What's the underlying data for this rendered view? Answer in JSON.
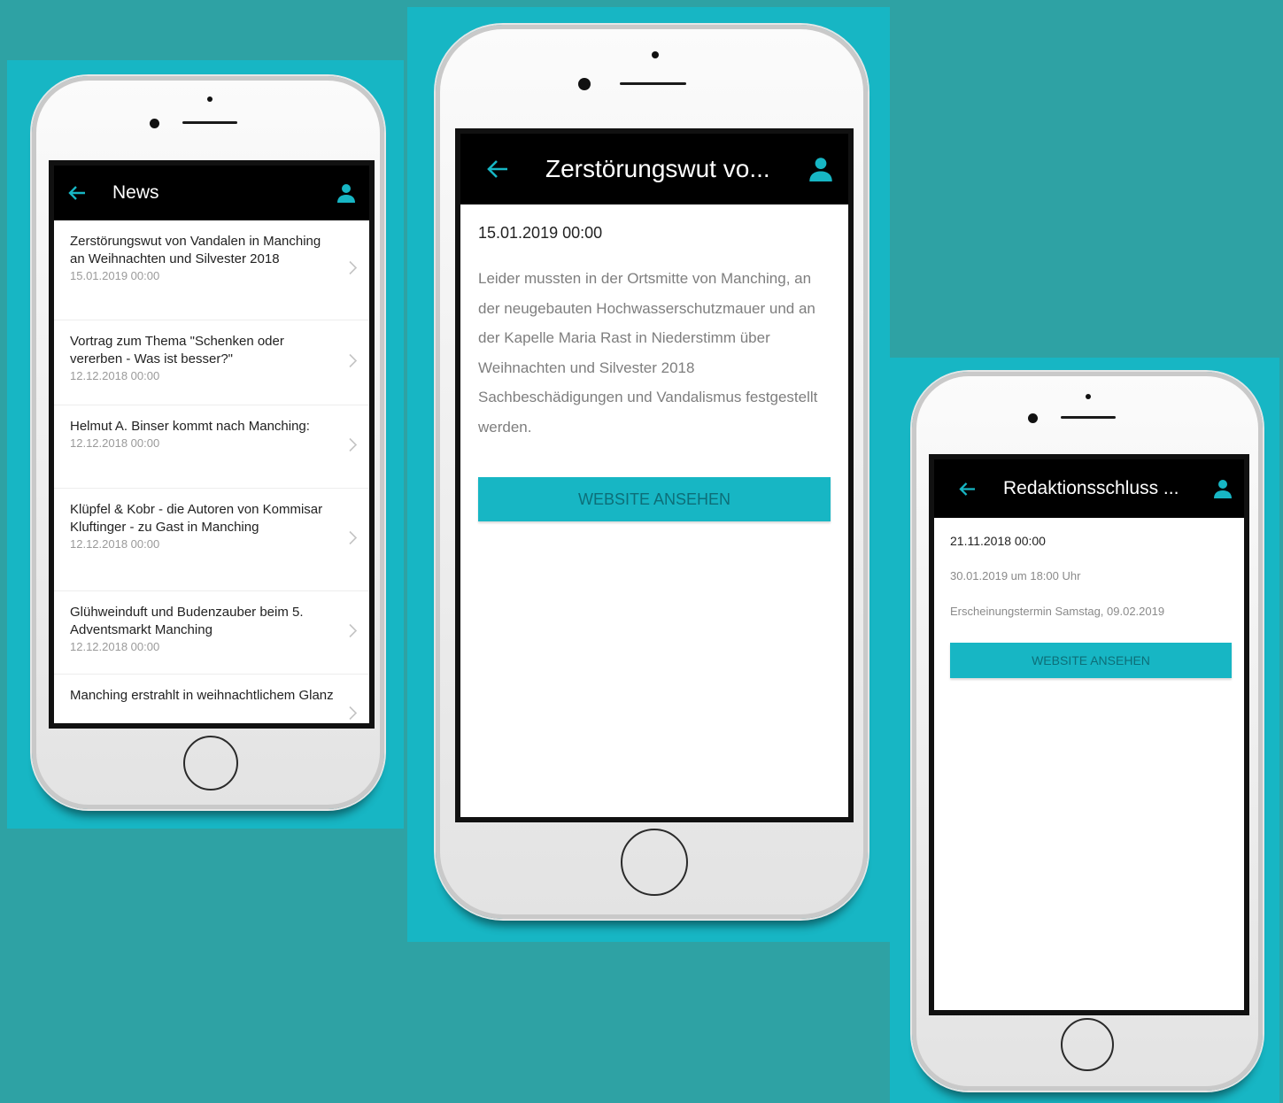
{
  "colors": {
    "accent": "#17b6c4",
    "background": "#2ea2a4",
    "appbar": "#000000"
  },
  "icons": {
    "back": "arrow-left-icon",
    "user": "user-icon",
    "chevron": "chevron-right-icon"
  },
  "phone1": {
    "appbar": {
      "title": "News"
    },
    "news": [
      {
        "title": "Zerstörungswut von Vandalen in Manching an Weihnachten und Silvester 2018",
        "date": "15.01.2019 00:00"
      },
      {
        "title": "Vortrag zum Thema \"Schenken oder vererben - Was ist besser?\"",
        "date": "12.12.2018 00:00"
      },
      {
        "title": "Helmut A. Binser kommt nach Manching:",
        "date": "12.12.2018 00:00"
      },
      {
        "title": "Klüpfel & Kobr - die Autoren von Kommisar Kluftinger - zu Gast in Manching",
        "date": "12.12.2018 00:00"
      },
      {
        "title": "Glühweinduft und Budenzauber beim 5. Adventsmarkt Manching",
        "date": "12.12.2018 00:00"
      },
      {
        "title": "Manching erstrahlt in weihnachtlichem Glanz",
        "date": ""
      }
    ]
  },
  "phone2": {
    "appbar": {
      "title": "Zerstörungswut vo..."
    },
    "date": "15.01.2019 00:00",
    "body": "Leider mussten in der Ortsmitte von Manching, an der neugebauten Hochwasserschutzmauer und an der Kapelle Maria Rast in Niederstimm über Weihnachten und Silvester 2018 Sachbeschädigungen und Vandalismus festgestellt werden.",
    "button": "WEBSITE ANSEHEN"
  },
  "phone3": {
    "appbar": {
      "title": "Redaktionsschluss ..."
    },
    "date": "21.11.2018 00:00",
    "line1": "30.01.2019 um 18:00 Uhr",
    "line2": "Erscheinungstermin Samstag, 09.02.2019",
    "button": "WEBSITE ANSEHEN"
  }
}
